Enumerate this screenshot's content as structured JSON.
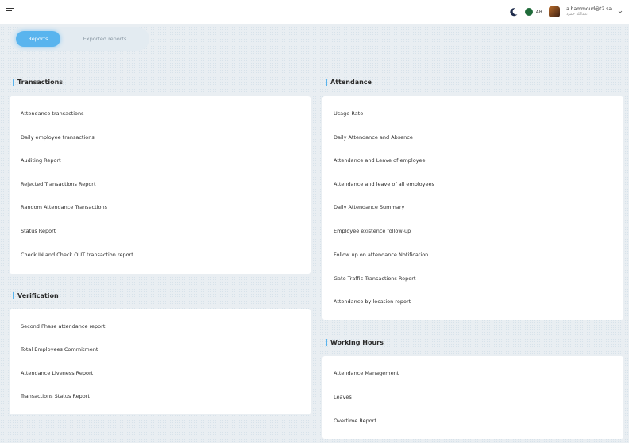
{
  "user": {
    "email": "a.hammoud@t2.sa",
    "subtitle": "عبدالله حمود"
  },
  "language": "AR",
  "tabs": {
    "reports": "Reports",
    "exported": "Exported reports"
  },
  "sections": {
    "transactions": {
      "title": "Transactions",
      "items": [
        "Attendance transactions",
        "Daily employee transactions",
        "Auditing Report",
        "Rejected Transactions Report",
        "Random Attendance Transactions",
        "Status Report",
        "Check IN and Check OUT transaction report"
      ]
    },
    "verification": {
      "title": "Verification",
      "items": [
        "Second Phase attendance report",
        "Total Employees Commitment",
        "Attendance Liveness Report",
        "Transactions Status Report"
      ]
    },
    "attendance": {
      "title": "Attendance",
      "items": [
        "Usage Rate",
        "Daily Attendance and Absence",
        "Attendance and Leave of employee",
        "Attendance and leave of all employees",
        "Daily Attendance Summary",
        "Employee existence follow-up",
        "Follow up on attendance Notification",
        "Gate Traffic Transactions Report",
        "Attendance by location report"
      ]
    },
    "working_hours": {
      "title": "Working Hours",
      "items": [
        "Attendance Management",
        "Leaves",
        "Overtime Report"
      ]
    }
  },
  "colors": {
    "accent": "#59b4ee",
    "card": "#ffffff",
    "background": "#e9eef2"
  }
}
